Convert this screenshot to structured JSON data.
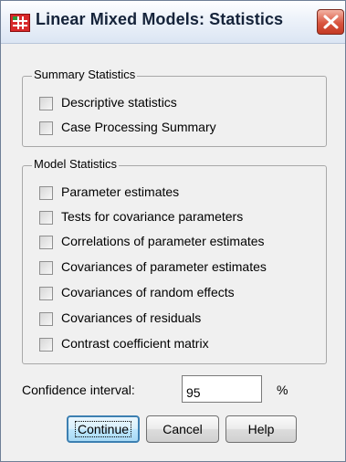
{
  "window": {
    "title": "Linear Mixed Models: Statistics",
    "app_icon": "spss-table-icon",
    "close_icon": "close-icon"
  },
  "summary_statistics": {
    "label": "Summary Statistics",
    "items": [
      {
        "label": "Descriptive statistics",
        "checked": false
      },
      {
        "label": "Case Processing Summary",
        "checked": false
      }
    ]
  },
  "model_statistics": {
    "label": "Model Statistics",
    "items": [
      {
        "label": "Parameter estimates",
        "checked": false
      },
      {
        "label": "Tests for covariance parameters",
        "checked": false
      },
      {
        "label": "Correlations of parameter estimates",
        "checked": false
      },
      {
        "label": "Covariances of parameter estimates",
        "checked": false
      },
      {
        "label": "Covariances of random effects",
        "checked": false
      },
      {
        "label": "Covariances of residuals",
        "checked": false
      },
      {
        "label": "Contrast coefficient matrix",
        "checked": false
      }
    ]
  },
  "confidence_interval": {
    "label": "Confidence interval:",
    "value": "95",
    "unit": "%"
  },
  "buttons": {
    "continue": "Continue",
    "cancel": "Cancel",
    "help": "Help"
  },
  "colors": {
    "close_button": "#d9553f",
    "default_button_border": "#3c7fb1"
  }
}
